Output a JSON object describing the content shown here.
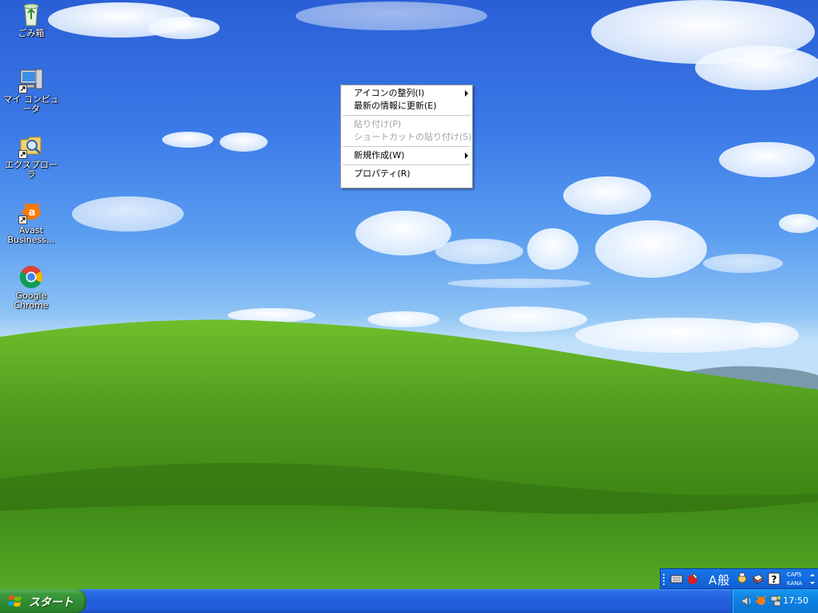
{
  "desktop": {
    "icons": [
      {
        "label": "ごみ箱",
        "icon": "recycle-bin-icon"
      },
      {
        "label": "マイ コンピュータ",
        "icon": "my-computer-icon"
      },
      {
        "label": "エクスプローラ",
        "icon": "explorer-icon"
      },
      {
        "label": "Avast Business...",
        "icon": "avast-icon"
      },
      {
        "label": "Google Chrome",
        "icon": "chrome-icon"
      }
    ]
  },
  "context_menu": {
    "items": [
      {
        "label": "アイコンの整列(I)",
        "disabled": false,
        "submenu": true
      },
      {
        "label": "最新の情報に更新(E)",
        "disabled": false,
        "submenu": false
      },
      {
        "label": "貼り付け(P)",
        "disabled": true,
        "submenu": false
      },
      {
        "label": "ショートカットの貼り付け(S)",
        "disabled": true,
        "submenu": false
      },
      {
        "label": "新規作成(W)",
        "disabled": false,
        "submenu": true
      },
      {
        "label": "プロパティ(R)",
        "disabled": false,
        "submenu": false
      }
    ]
  },
  "taskbar": {
    "start_label": "スタート",
    "clock": "17:50",
    "tray_icons": [
      "speaker-icon",
      "avast-tray-icon",
      "network-icon"
    ]
  },
  "language_bar": {
    "ime_text": "A般",
    "caps_label": "CAPS",
    "kana_label": "KANA",
    "icons": [
      "keyboard-icon",
      "ime-pad-icon",
      "ime-tool-icon",
      "dictionary-icon",
      "help-icon"
    ]
  },
  "colors": {
    "taskbar_blue": "#245edb",
    "start_green": "#3d9a3d",
    "tray_blue": "#0d84e4",
    "menu_disabled": "#a3a3a3"
  }
}
